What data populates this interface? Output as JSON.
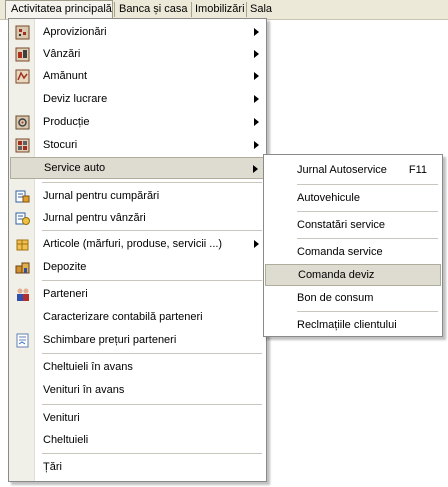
{
  "menubar": {
    "items": [
      "Activitatea principală",
      "Banca și casa",
      "Imobilizări",
      "Sala"
    ]
  },
  "main_menu": {
    "items": [
      {
        "label": "Aprovizionări",
        "icon": "supply-icon",
        "submenu": true
      },
      {
        "label": "Vânzări",
        "icon": "sales-icon",
        "submenu": true
      },
      {
        "label": "Amănunt",
        "icon": "retail-icon",
        "submenu": true
      },
      {
        "label": "Deviz lucrare",
        "icon": "",
        "submenu": true
      },
      {
        "label": "Producție",
        "icon": "production-icon",
        "submenu": true
      },
      {
        "label": "Stocuri",
        "icon": "stocks-icon",
        "submenu": true
      },
      {
        "label": "Service auto",
        "icon": "",
        "submenu": true,
        "highlighted": true
      },
      {
        "label": "Jurnal pentru cumpărări",
        "icon": "purchase-journal-icon"
      },
      {
        "label": "Jurnal pentru vânzări",
        "icon": "sales-journal-icon"
      },
      {
        "label": "Articole (mărfuri, produse, servicii ...)",
        "icon": "articles-icon",
        "submenu": true
      },
      {
        "label": "Depozite",
        "icon": "warehouse-icon"
      },
      {
        "label": "Parteneri",
        "icon": "partners-icon"
      },
      {
        "label": "Caracterizare contabilă parteneri",
        "icon": ""
      },
      {
        "label": "Schimbare prețuri parteneri",
        "icon": "price-change-icon"
      },
      {
        "label": "Cheltuieli în avans",
        "icon": ""
      },
      {
        "label": "Venituri în avans",
        "icon": ""
      },
      {
        "label": "Venituri",
        "icon": ""
      },
      {
        "label": "Cheltuieli",
        "icon": ""
      },
      {
        "label": "Țări",
        "icon": ""
      }
    ]
  },
  "sub_menu": {
    "items": [
      {
        "label": "Jurnal Autoservice",
        "shortcut": "F11"
      },
      {
        "label": "Autovehicule"
      },
      {
        "label": "Constatări service"
      },
      {
        "label": "Comanda service"
      },
      {
        "label": "Comanda deviz",
        "highlighted": true
      },
      {
        "label": "Bon de consum"
      },
      {
        "label": "Reclmațiile clientului"
      }
    ]
  }
}
